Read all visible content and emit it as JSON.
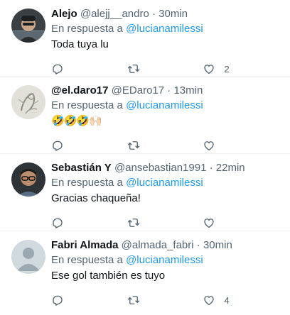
{
  "tweets": [
    {
      "name": "Alejo",
      "handle": "@alejj__andro",
      "time": "30min",
      "reply_prefix": "En respuesta a",
      "reply_to": "@lucianamilessi",
      "text": "Toda tuya lu",
      "likes": "2",
      "avatar": "photo-dark"
    },
    {
      "name": "@el.daro17",
      "handle": "@EDaro17",
      "time": "13min",
      "reply_prefix": "En respuesta a",
      "reply_to": "@lucianamilessi",
      "text": "🤣🤣🤣🙌🏻",
      "likes": "",
      "avatar": "sketch"
    },
    {
      "name": "Sebastián Y",
      "handle": "@ansebastian1991",
      "time": "22min",
      "reply_prefix": "En respuesta a",
      "reply_to": "@lucianamilessi",
      "text": "Gracias chaqueña!",
      "likes": "",
      "avatar": "photo-glasses"
    },
    {
      "name": "Fabri Almada",
      "handle": "@almada_fabri",
      "time": "30min",
      "reply_prefix": "En respuesta a",
      "reply_to": "@lucianamilessi",
      "text": "Ese gol también es tuyo",
      "likes": "4",
      "avatar": "default-silhouette"
    }
  ],
  "separator": "·",
  "icons": [
    "reply-icon",
    "retweet-icon",
    "like-icon"
  ],
  "colors": {
    "link": "#1d9bf0",
    "secondary": "#536471",
    "text": "#0f1419"
  }
}
